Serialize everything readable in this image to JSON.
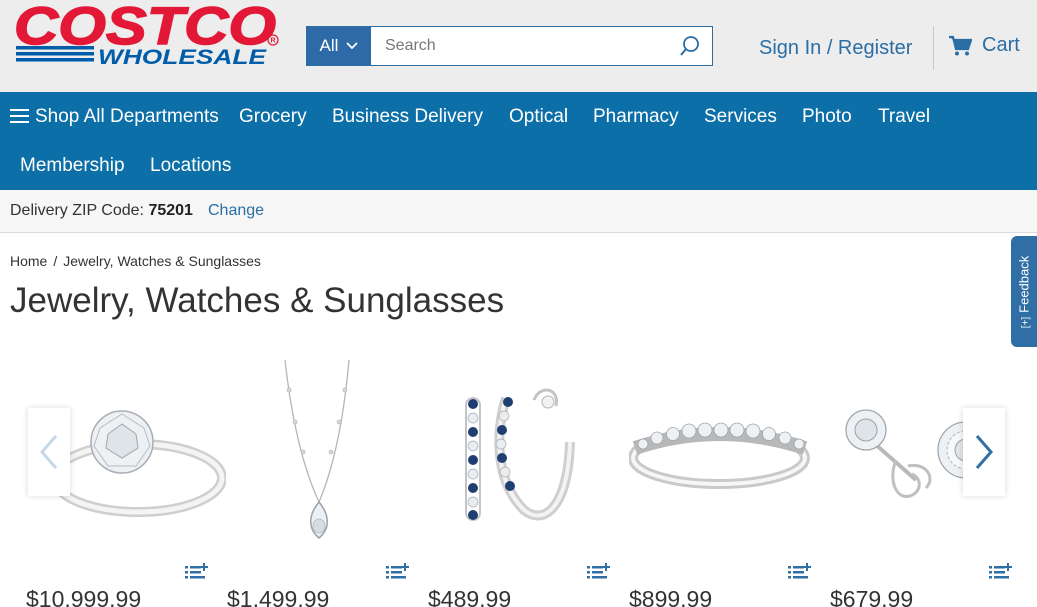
{
  "header": {
    "logo_text_top": "COSTCO",
    "logo_text_bottom": "WHOLESALE",
    "search": {
      "category": "All",
      "placeholder": "Search"
    },
    "signin_label": "Sign In / Register",
    "cart_label": "Cart"
  },
  "nav": {
    "items": [
      "Shop All Departments",
      "Grocery",
      "Business Delivery",
      "Optical",
      "Pharmacy",
      "Services",
      "Photo",
      "Travel",
      "Membership",
      "Locations"
    ]
  },
  "zip": {
    "label": "Delivery ZIP Code:",
    "value": "75201",
    "change_label": "Change"
  },
  "breadcrumb": {
    "home": "Home",
    "separator": "/",
    "current": "Jewelry, Watches & Sunglasses"
  },
  "page_title": "Jewelry, Watches & Sunglasses",
  "feedback_label": "Feedback",
  "products": [
    {
      "name": "solitaire-diamond-ring",
      "price": "$10,999.99"
    },
    {
      "name": "diamond-pendant-necklace",
      "price": "$1,499.99"
    },
    {
      "name": "sapphire-hoop-earrings",
      "price": "$489.99"
    },
    {
      "name": "diamond-band-ring",
      "price": "$899.99"
    },
    {
      "name": "diamond-stud-earrings",
      "price": "$679.99"
    }
  ],
  "colors": {
    "brand_red": "#e31837",
    "brand_blue": "#005daa",
    "nav_blue": "#0c6fa8",
    "link_blue": "#2a6ea5"
  }
}
